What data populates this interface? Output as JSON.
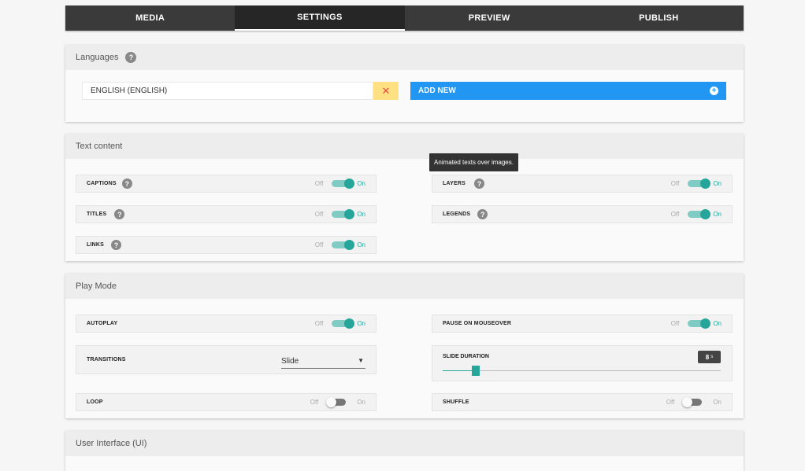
{
  "tabs": [
    "MEDIA",
    "SETTINGS",
    "PREVIEW",
    "PUBLISH"
  ],
  "active_tab": "SETTINGS",
  "languages": {
    "title": "Languages",
    "selected": "ENGLISH (ENGLISH)",
    "add_label": "ADD NEW"
  },
  "text_content": {
    "title": "Text content",
    "tooltip": "Animated texts over images.",
    "items": [
      {
        "label": "CAPTIONS",
        "state": "on"
      },
      {
        "label": "LAYERS",
        "state": "on"
      },
      {
        "label": "TITLES",
        "state": "on"
      },
      {
        "label": "LEGENDS",
        "state": "on"
      },
      {
        "label": "LINKS",
        "state": "on"
      }
    ]
  },
  "play_mode": {
    "title": "Play Mode",
    "autoplay": {
      "label": "AUTOPLAY",
      "state": "on"
    },
    "pause": {
      "label": "PAUSE ON MOUSEOVER",
      "state": "on"
    },
    "transitions": {
      "label": "TRANSITIONS",
      "value": "Slide"
    },
    "slide_duration": {
      "label": "SLIDE DURATION",
      "value": "8",
      "unit": "s",
      "level": 0.12
    },
    "loop": {
      "label": "LOOP",
      "state": "off"
    },
    "shuffle": {
      "label": "SHUFFLE",
      "state": "off"
    }
  },
  "ui_panel": {
    "title": "User Interface (UI)"
  },
  "toggle_text": {
    "off": "Off",
    "on": "On"
  },
  "colors": {
    "accent": "#26a69a",
    "primary": "#2196f3",
    "warning": "#ffe082",
    "tab_bar": "#3a3a3a"
  }
}
